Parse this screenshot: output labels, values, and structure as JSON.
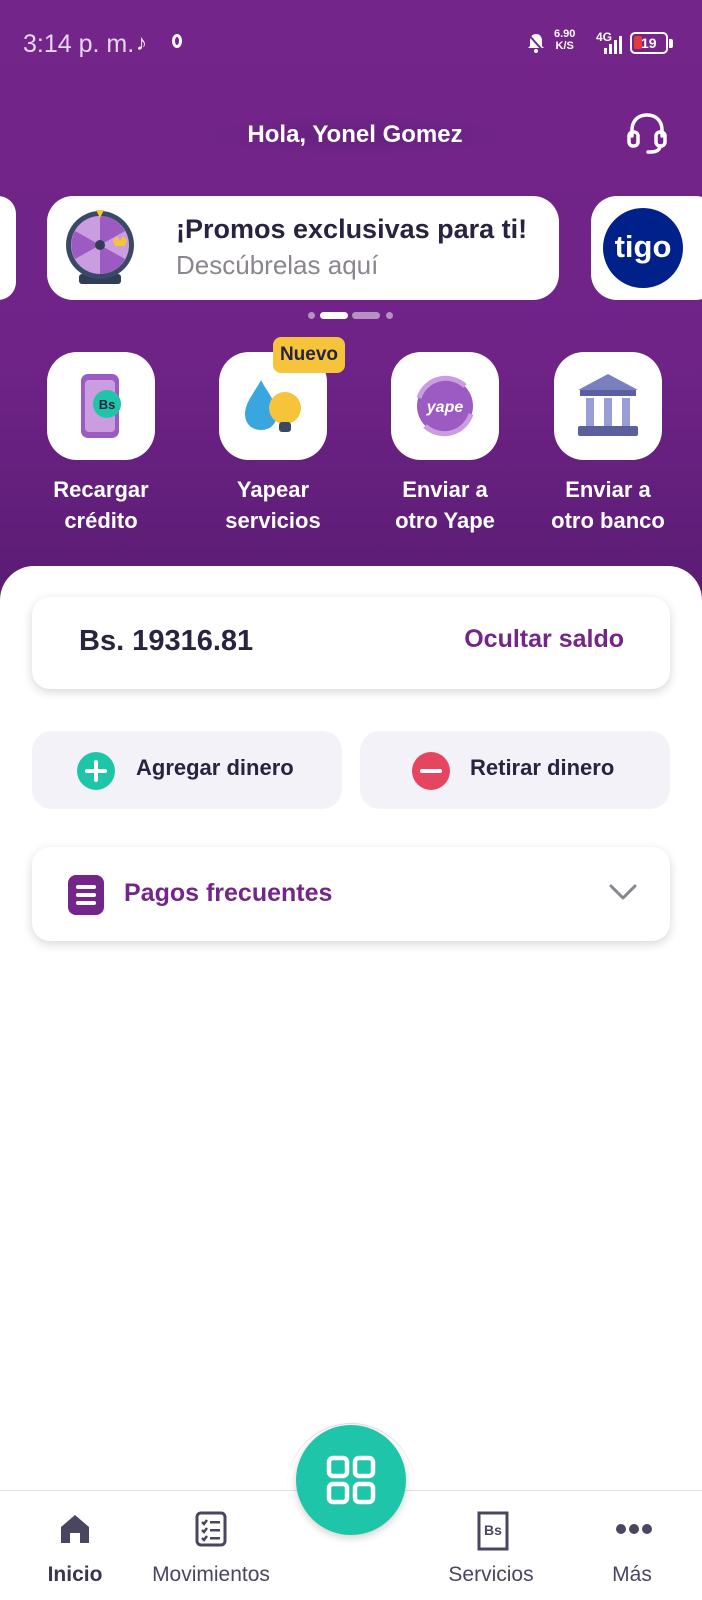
{
  "status_bar": {
    "time": "3:14 p. m.",
    "speed_value": "6.90",
    "speed_unit": "K/S",
    "network": "4G",
    "battery": "19"
  },
  "header": {
    "greeting": "Hola, Yonel Gomez"
  },
  "banner": {
    "title": "¡Promos exclusivas para ti!",
    "subtitle": "Descúbrelas aquí",
    "next_logo_text": "tigo",
    "active_dot": 1,
    "dot_count": 3
  },
  "quick_actions": [
    {
      "label_1": "Recargar",
      "label_2": "crédito",
      "icon": "phone-topup-icon"
    },
    {
      "label_1": "Yapear",
      "label_2": "servicios",
      "icon": "water-light-icon",
      "badge": "Nuevo"
    },
    {
      "label_1": "Enviar a",
      "label_2": "otro Yape",
      "icon": "yape-transfer-icon",
      "icon_text": "yape"
    },
    {
      "label_1": "Enviar a",
      "label_2": "otro banco",
      "icon": "bank-icon"
    }
  ],
  "balance": {
    "amount": "Bs. 19316.81",
    "hide_label": "Ocultar saldo"
  },
  "actions": {
    "add_label": "Agregar dinero",
    "withdraw_label": "Retirar dinero"
  },
  "frequent": {
    "label": "Pagos frecuentes"
  },
  "bottom_nav": {
    "home": "Inicio",
    "movements": "Movimientos",
    "services": "Servicios",
    "more": "Más",
    "services_icon_text": "Bs"
  },
  "colors": {
    "brand_purple": "#74258a",
    "accent_teal": "#1fc5a8",
    "withdraw_red": "#e5455e",
    "badge_yellow": "#f5c43a"
  }
}
